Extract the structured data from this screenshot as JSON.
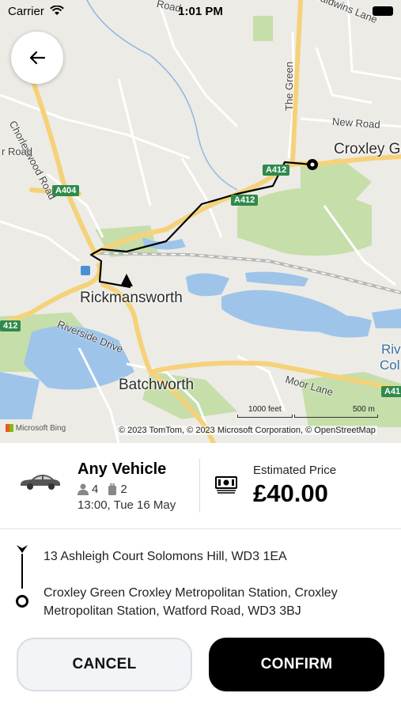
{
  "status_bar": {
    "carrier": "Carrier",
    "time": "1:01 PM"
  },
  "map": {
    "labels": {
      "rickmansworth": "Rickmansworth",
      "batchworth": "Batchworth",
      "croxley": "Croxley G",
      "river_line1": "Riv",
      "river_line2": "Col",
      "chorleywood_road": "Chorleywood Road",
      "road_left": "r Road",
      "new_road": "New Road",
      "the_green": "The Green",
      "baldwins_lane": "Baldwins Lane",
      "riverside_drive": "Riverside Drive",
      "moor_lane": "Moor Lane",
      "top_street": "Road"
    },
    "shields": {
      "a404": "A404",
      "a412_a": "A412",
      "a412_b": "A412",
      "a412_left": "412",
      "a41_right": "A41"
    },
    "scale_feet": "1000 feet",
    "scale_m": "500 m",
    "bing": "Microsoft Bing",
    "attribution": "© 2023 TomTom, © 2023 Microsoft Corporation, © OpenStreetMap"
  },
  "booking": {
    "vehicle_name": "Any Vehicle",
    "passengers": "4",
    "luggage": "2",
    "datetime": "13:00, Tue 16 May",
    "price_label": "Estimated Price",
    "price": "£40.00"
  },
  "route": {
    "pickup": "13 Ashleigh Court Solomons Hill, WD3 1EA",
    "dropoff": "Croxley Green Croxley Metropolitan Station, Croxley Metropolitan Station, Watford Road, WD3 3BJ"
  },
  "actions": {
    "cancel": "CANCEL",
    "confirm": "CONFIRM"
  },
  "colors": {
    "route": "#000000",
    "water": "#9ec4ea",
    "park": "#c6deaa",
    "major_road": "#f5d27a",
    "confirm_bg": "#000000"
  }
}
